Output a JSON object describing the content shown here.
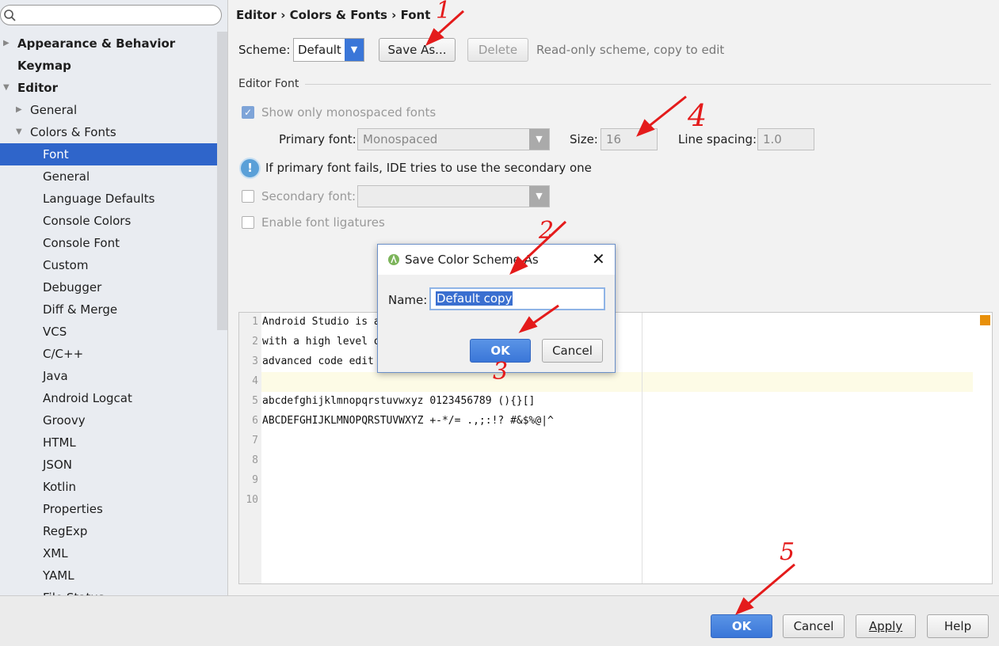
{
  "sidebar": {
    "search_placeholder": "",
    "items": [
      {
        "label": "Appearance & Behavior",
        "bold": true,
        "indent": 0,
        "arrow": "right"
      },
      {
        "label": "Keymap",
        "bold": true,
        "indent": 0,
        "arrow": ""
      },
      {
        "label": "Editor",
        "bold": true,
        "indent": 0,
        "arrow": "down"
      },
      {
        "label": "General",
        "bold": false,
        "indent": 1,
        "arrow": "right"
      },
      {
        "label": "Colors & Fonts",
        "bold": false,
        "indent": 1,
        "arrow": "down"
      },
      {
        "label": "Font",
        "bold": false,
        "indent": 2,
        "arrow": "",
        "selected": true
      },
      {
        "label": "General",
        "indent": 2
      },
      {
        "label": "Language Defaults",
        "indent": 2
      },
      {
        "label": "Console Colors",
        "indent": 2
      },
      {
        "label": "Console Font",
        "indent": 2
      },
      {
        "label": "Custom",
        "indent": 2
      },
      {
        "label": "Debugger",
        "indent": 2
      },
      {
        "label": "Diff & Merge",
        "indent": 2
      },
      {
        "label": "VCS",
        "indent": 2
      },
      {
        "label": "C/C++",
        "indent": 2
      },
      {
        "label": "Java",
        "indent": 2
      },
      {
        "label": "Android Logcat",
        "indent": 2
      },
      {
        "label": "Groovy",
        "indent": 2
      },
      {
        "label": "HTML",
        "indent": 2
      },
      {
        "label": "JSON",
        "indent": 2
      },
      {
        "label": "Kotlin",
        "indent": 2
      },
      {
        "label": "Properties",
        "indent": 2
      },
      {
        "label": "RegExp",
        "indent": 2
      },
      {
        "label": "XML",
        "indent": 2
      },
      {
        "label": "YAML",
        "indent": 2
      },
      {
        "label": "File Status",
        "indent": 2
      }
    ]
  },
  "breadcrumb": "Editor › Colors & Fonts › Font",
  "scheme": {
    "label": "Scheme:",
    "value": "Default",
    "save_as": "Save As...",
    "delete": "Delete",
    "note": "Read-only scheme, copy to edit"
  },
  "editor_font": {
    "section": "Editor Font",
    "show_mono": "Show only monospaced fonts",
    "primary_label": "Primary font:",
    "primary_value": "Monospaced",
    "size_label": "Size:",
    "size_value": "16",
    "spacing_label": "Line spacing:",
    "spacing_value": "1.0",
    "info": "If primary font fails, IDE tries to use the secondary one",
    "secondary_label": "Secondary font:",
    "ligatures": "Enable font ligatures"
  },
  "preview": {
    "lines": [
      "Android Studio is a",
      "with a high level o",
      "advanced code edit",
      "",
      "abcdefghijklmnopqrstuvwxyz 0123456789 (){}[]",
      "ABCDEFGHIJKLMNOPQRSTUVWXYZ +-*/= .,;:!? #&$%@|^",
      "",
      "",
      "",
      ""
    ]
  },
  "dialog": {
    "title": "Save Color Scheme As",
    "name_label": "Name:",
    "name_value": "Default copy",
    "ok": "OK",
    "cancel": "Cancel"
  },
  "footer": {
    "ok": "OK",
    "cancel": "Cancel",
    "apply": "Apply",
    "help": "Help"
  },
  "annotations": [
    "1",
    "2",
    "3",
    "4",
    "5"
  ],
  "colors": {
    "accent": "#2f65ca",
    "annotation": "#e41b1b"
  }
}
